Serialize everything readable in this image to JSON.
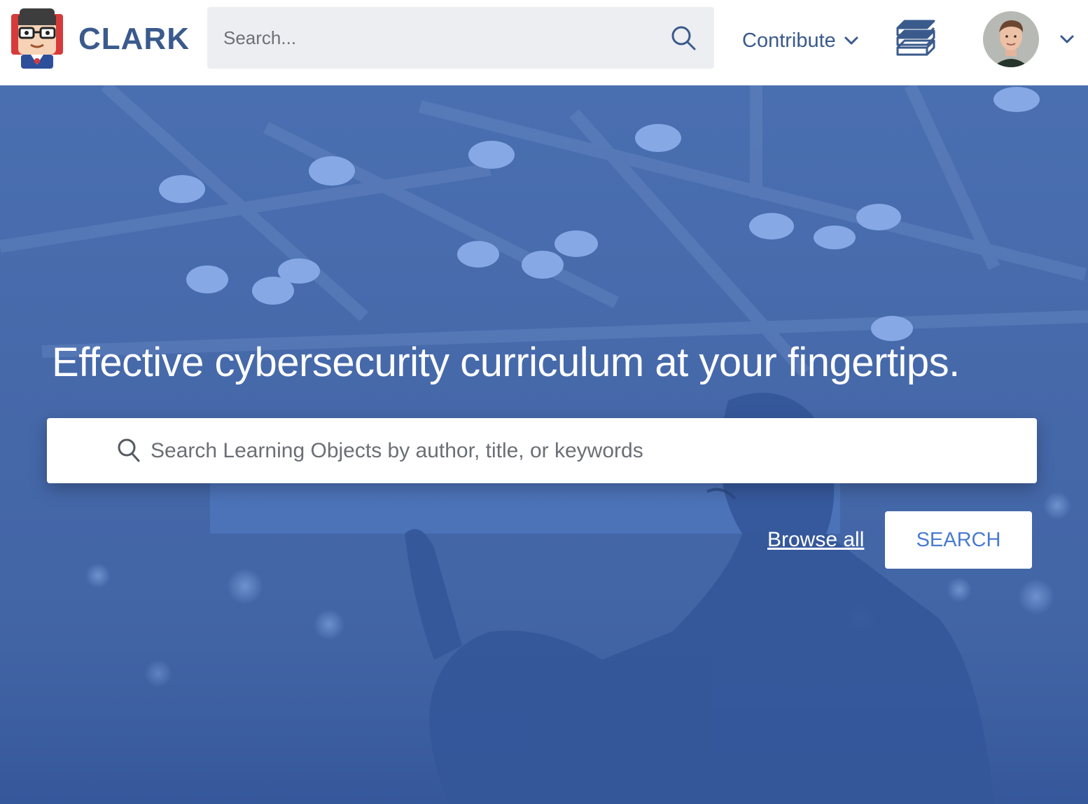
{
  "header": {
    "brand": "CLARK",
    "search_placeholder": "Search...",
    "contribute_label": "Contribute",
    "icons": {
      "logo": "clark-mascot-icon",
      "search": "search-icon",
      "contribute_caret": "chevron-down-icon",
      "library": "books-icon",
      "avatar": "user-avatar",
      "avatar_caret": "chevron-down-icon"
    }
  },
  "hero": {
    "title": "Effective cybersecurity curriculum at your fingertips.",
    "search_placeholder": "Search Learning Objects by author, title, or keywords",
    "browse_all_label": "Browse all",
    "search_button_label": "SEARCH"
  },
  "colors": {
    "brand_blue": "#3a5a8c",
    "hero_overlay": "#4669aa",
    "accent": "#4a7bd0",
    "search_bg": "#eceef1"
  }
}
